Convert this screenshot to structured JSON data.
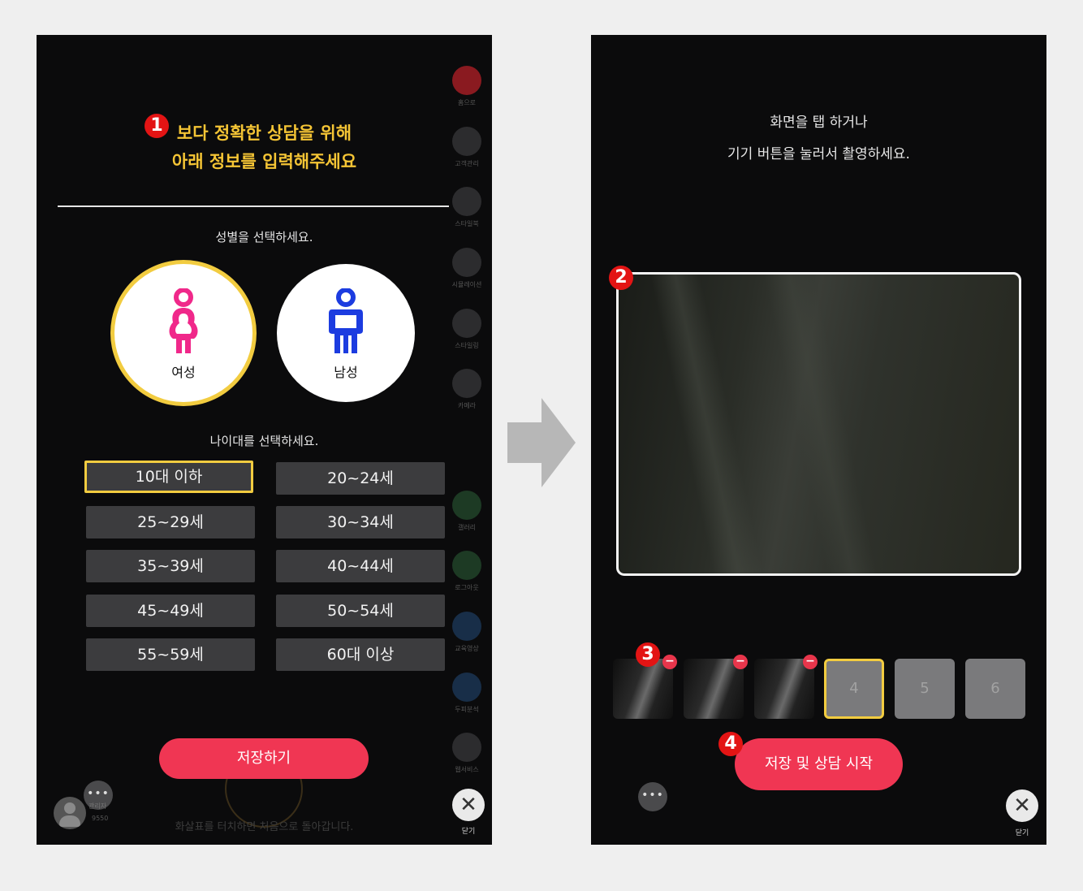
{
  "left": {
    "step_badge": "1",
    "title_lines": [
      "보다 정확한 상담을 위해",
      "아래 정보를 입력해주세요"
    ],
    "gender_prompt": "성별을 선택하세요.",
    "genders": [
      {
        "label": "여성",
        "selected": true,
        "color": "#f0288a"
      },
      {
        "label": "남성",
        "selected": false,
        "color": "#1c3ce0"
      }
    ],
    "age_prompt": "나이대를 선택하세요.",
    "ages": [
      "10대 이하",
      "20~24세",
      "25~29세",
      "30~34세",
      "35~39세",
      "40~44세",
      "45~49세",
      "50~54세",
      "55~59세",
      "60대 이상"
    ],
    "selected_age": "10대 이하",
    "save_label": "저장하기",
    "footer_hint": "화살표를 터치하면 처음으로 돌아갑니다.",
    "dots_label": "•••",
    "user_badge": "관리자",
    "user_code": "9550",
    "side_nav": [
      {
        "label": "홈으로",
        "icon": "home-icon",
        "color": "#b3141e"
      },
      {
        "label": "고객관리",
        "icon": "customer-card-icon",
        "color": "#2c2c2e"
      },
      {
        "label": "스타일북",
        "icon": "book-icon",
        "color": "#2c2c2e"
      },
      {
        "label": "시뮬레이션",
        "icon": "scissors-icon",
        "color": "#2c2c2e"
      },
      {
        "label": "스타일링",
        "icon": "tablet-icon",
        "color": "#2c2c2e"
      },
      {
        "label": "카메라",
        "icon": "camera-icon",
        "color": "#2c2c2e"
      },
      {
        "label": "갤러리",
        "icon": "gallery-icon",
        "color": "#1d4a2a"
      },
      {
        "label": "로그아웃",
        "icon": "logout-icon",
        "color": "#1d4a2a"
      },
      {
        "label": "교육영상",
        "icon": "video-icon",
        "color": "#1a3a5a"
      },
      {
        "label": "두피분석",
        "icon": "drop-icon",
        "color": "#1a3a5a"
      },
      {
        "label": "웹서비스",
        "icon": "globe-icon",
        "color": "#2c2c2e"
      }
    ],
    "close_label": "닫기"
  },
  "right": {
    "instruction_lines": [
      "화면을 탭 하거나",
      "기기 버튼을 눌러서 촬영하세요."
    ],
    "preview_badge": "2",
    "thumbs_badge": "3",
    "thumbnails": [
      {
        "label": "",
        "filled": true
      },
      {
        "label": "",
        "filled": true
      },
      {
        "label": "",
        "filled": true
      },
      {
        "label": "4",
        "filled": false,
        "selected": true
      },
      {
        "label": "5",
        "filled": false
      },
      {
        "label": "6",
        "filled": false
      }
    ],
    "remove_symbol": "−",
    "start_badge": "4",
    "start_label": "저장 및 상담 시작",
    "dots_label": "•••",
    "close_label": "닫기"
  },
  "colors": {
    "accent": "#f03653",
    "highlight": "#f2cc40",
    "title": "#f5c535"
  }
}
